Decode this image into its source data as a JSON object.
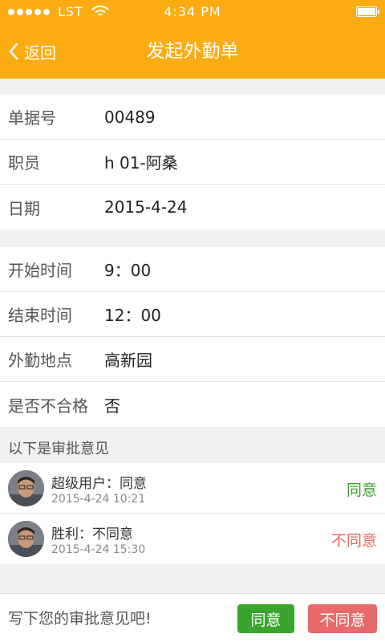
{
  "status_bar": {
    "carrier": "LST",
    "time": "4:34 PM"
  },
  "header": {
    "back_label": "返回",
    "title": "发起外勤单"
  },
  "info_rows": [
    {
      "label": "单据号",
      "value": "00489"
    },
    {
      "label": "职员",
      "value": "h 01-阿桑"
    },
    {
      "label": "日期",
      "value": "2015-4-24"
    }
  ],
  "detail_rows": [
    {
      "label": "开始时间",
      "value": "9：00"
    },
    {
      "label": "结束时间",
      "value": "12：00"
    },
    {
      "label": "外勤地点",
      "value": "高新园"
    },
    {
      "label": "是否不合格",
      "value": "否"
    }
  ],
  "approval": {
    "section_title": "以下是审批意见",
    "comments": [
      {
        "name": "超级用户：同意",
        "date": "2015-4-24  10:21",
        "status": "同意",
        "status_color": "#39a52c"
      },
      {
        "name": "胜利：不同意",
        "date": "2015-4-24 15:30",
        "status": "不同意",
        "status_color": "#e86a6a"
      }
    ]
  },
  "bottom": {
    "input_placeholder": "写下您的审批意见吧!",
    "agree_label": "同意",
    "reject_label": "不同意"
  },
  "colors": {
    "header": "#fbac13",
    "agree": "#39a52c",
    "reject": "#e86a6a"
  }
}
